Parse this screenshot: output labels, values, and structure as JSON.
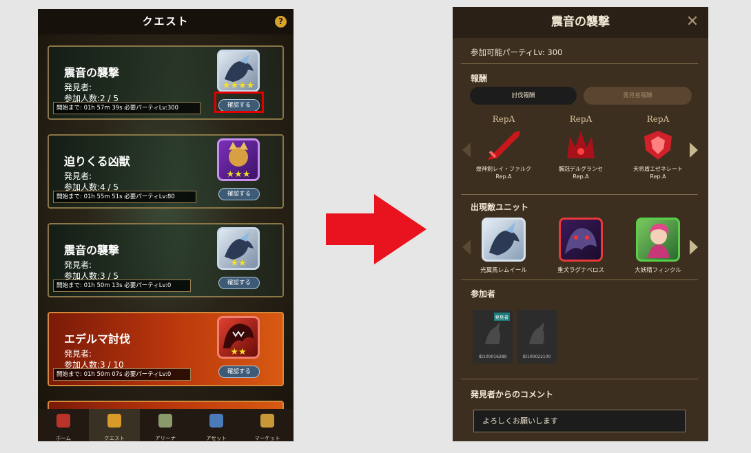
{
  "left": {
    "header_title": "クエスト",
    "help_icon": "?",
    "quests": [
      {
        "title": "震音の襲撃",
        "finder": "発見者:",
        "participants": "参加人数:2 / 5",
        "info": "開始まで: 01h 57m 39s  必要パーティLv:300",
        "stars": "★★★★",
        "button": "確認する"
      },
      {
        "title": "迫りくる凶獣",
        "finder": "発見者:",
        "participants": "参加人数:4 / 5",
        "info": "開始まで: 01h 55m 51s  必要パーティLv:80",
        "stars": "★★★",
        "button": "確認する"
      },
      {
        "title": "震音の襲撃",
        "finder": "発見者:",
        "participants": "参加人数:3 / 5",
        "info": "開始まで: 01h 50m 13s  必要パーティLv:0",
        "stars": "★★",
        "button": "確認する"
      },
      {
        "title": "エデルマ討伐",
        "finder": "発見者:",
        "participants": "参加人数:3 / 10",
        "info": "開始まで: 01h 50m 07s  必要パーティLv:0",
        "stars": "★★",
        "button": "確認する"
      }
    ],
    "nav": [
      "ホーム",
      "クエスト",
      "アリーナ",
      "アセット",
      "マーケット"
    ]
  },
  "right": {
    "header_title": "震音の襲撃",
    "close_icon": "close-icon",
    "party_lv": "参加可能パーティLv: 300",
    "rewards_heading": "報酬",
    "tab_active": "討伐報酬",
    "tab_inactive": "発見者報酬",
    "rewards": [
      {
        "rep": "RepA",
        "name": "煌神剣レイ・ファルク",
        "grade": "Rep.A"
      },
      {
        "rep": "RepA",
        "name": "髑冠デルグランセ",
        "grade": "Rep.A"
      },
      {
        "rep": "RepA",
        "name": "天将盾エゼネレート",
        "grade": "Rep.A"
      }
    ],
    "enemies_heading": "出現敵ユニット",
    "enemies": [
      {
        "name": "光翼馬レムイール"
      },
      {
        "name": "重犬ラグナベロス"
      },
      {
        "name": "大妖精フィンクル"
      }
    ],
    "participants_heading": "参加者",
    "participants": [
      {
        "id": "ID100016289",
        "tag": "発見者"
      },
      {
        "id": "ID100022100",
        "tag": ""
      }
    ],
    "comment_heading": "発見者からのコメント",
    "comment": "よろしくお願いします"
  },
  "colors": {
    "highlight": "#e00000",
    "arrow": "#e8131e"
  }
}
